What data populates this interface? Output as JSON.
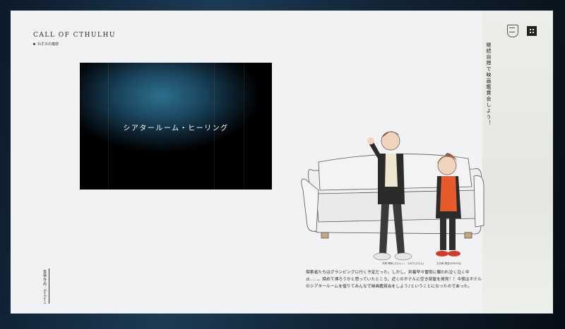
{
  "brand": "CALL OF CTHULHU",
  "subtitle": "ねずみの魔窟",
  "video": {
    "title": "シアタールーム・ヒーリング"
  },
  "sidebar": {
    "vertical_text": "継続自陣で映画鑑賞会しよう！",
    "side_label": "登場作品：Reflect"
  },
  "description": "探索者たちはグランピングに行く予定だった。しかし、到着早々雷雨に襲われ泣く泣く中止……。諦めて帰ろうかと思っていたところ、近くのホテルに空き部屋を発見！！今夜はホテルのシアタールームを借りてみんなで映画鑑賞会をしよう♪ということになったのであった。",
  "captions": {
    "left": "芦原 弾彦(ぶらんく)　うねり(ぷらん)",
    "right": "五月雨 美苗(ゆみかる)"
  },
  "icons": {
    "emblem": "crest-icon",
    "qr": "qr-code-icon"
  }
}
